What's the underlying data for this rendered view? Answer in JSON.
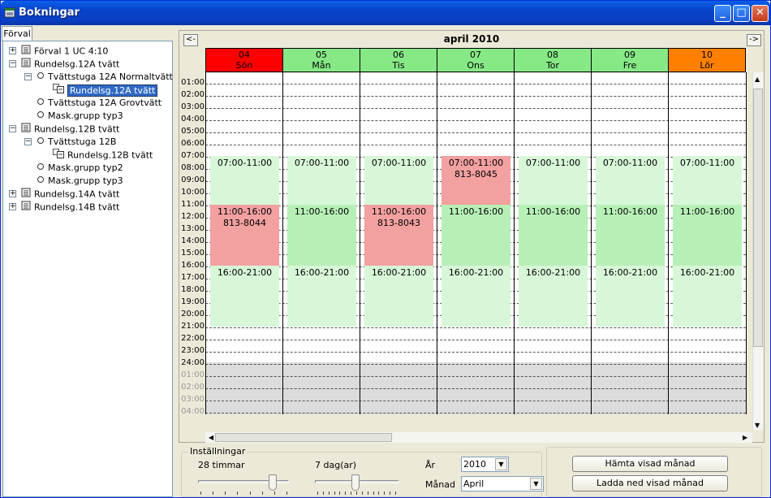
{
  "window": {
    "title": "Bokningar",
    "minimize": "_",
    "maximize": "□",
    "close": "✕"
  },
  "tab_label": "Förval",
  "tree": [
    {
      "label": "Förval   1 UC 4:10",
      "expander": "+",
      "icon": "list-icon"
    },
    {
      "label": "Rundelsg.12A tvätt",
      "expander": "−",
      "icon": "list-icon"
    },
    {
      "label": "Tvättstuga 12A Normaltvätt",
      "expander": "−",
      "icon": "circle-icon"
    },
    {
      "label": "Rundelsg.12A tvätt",
      "selected": true,
      "icon": "schedule-icon"
    },
    {
      "label": "Tvättstuga 12A Grovtvätt",
      "icon": "circle-icon"
    },
    {
      "label": "Mask.grupp typ3",
      "icon": "circle-icon"
    },
    {
      "label": "Rundelsg.12B tvätt",
      "expander": "−",
      "icon": "list-icon"
    },
    {
      "label": "Tvättstuga 12B",
      "expander": "−",
      "icon": "circle-icon"
    },
    {
      "label": "Rundelsg.12B tvätt",
      "icon": "schedule-icon"
    },
    {
      "label": "Mask.grupp typ2",
      "icon": "circle-icon"
    },
    {
      "label": "Mask.grupp typ3",
      "icon": "circle-icon"
    },
    {
      "label": "Rundelsg.14A tvätt",
      "expander": "+",
      "icon": "list-icon"
    },
    {
      "label": "Rundelsg.14B tvätt",
      "expander": "+",
      "icon": "list-icon"
    }
  ],
  "calendar": {
    "month_title": "april 2010",
    "prev": "<-",
    "next": "->",
    "days": [
      {
        "num": "04",
        "name": "Sön",
        "color": "#ff0000"
      },
      {
        "num": "05",
        "name": "Mån",
        "color": "#86e986"
      },
      {
        "num": "06",
        "name": "Tis",
        "color": "#86e986"
      },
      {
        "num": "07",
        "name": "Ons",
        "color": "#86e986"
      },
      {
        "num": "08",
        "name": "Tor",
        "color": "#86e986"
      },
      {
        "num": "09",
        "name": "Fre",
        "color": "#86e986"
      },
      {
        "num": "10",
        "name": "Lör",
        "color": "#ff8000"
      }
    ],
    "hours": [
      "01:00",
      "02:00",
      "03:00",
      "04:00",
      "05:00",
      "06:00",
      "07:00",
      "08:00",
      "09:00",
      "10:00",
      "11:00",
      "12:00",
      "13:00",
      "14:00",
      "15:00",
      "16:00",
      "17:00",
      "18:00",
      "19:00",
      "20:00",
      "21:00",
      "22:00",
      "23:00",
      "24:00",
      "01:00",
      "02:00",
      "03:00",
      "04:00"
    ],
    "slots": [
      [
        {
          "time": "07:00-11:00",
          "booking": "",
          "booked": false
        },
        {
          "time": "11:00-16:00",
          "booking": "813-8044",
          "booked": true
        },
        {
          "time": "16:00-21:00",
          "booking": "",
          "booked": false
        }
      ],
      [
        {
          "time": "07:00-11:00",
          "booking": "",
          "booked": false
        },
        {
          "time": "11:00-16:00",
          "booking": "",
          "booked": false
        },
        {
          "time": "16:00-21:00",
          "booking": "",
          "booked": false
        }
      ],
      [
        {
          "time": "07:00-11:00",
          "booking": "",
          "booked": false
        },
        {
          "time": "11:00-16:00",
          "booking": "813-8043",
          "booked": true
        },
        {
          "time": "16:00-21:00",
          "booking": "",
          "booked": false
        }
      ],
      [
        {
          "time": "07:00-11:00",
          "booking": "813-8045",
          "booked": true
        },
        {
          "time": "11:00-16:00",
          "booking": "",
          "booked": false
        },
        {
          "time": "16:00-21:00",
          "booking": "",
          "booked": false
        }
      ],
      [
        {
          "time": "07:00-11:00",
          "booking": "",
          "booked": false
        },
        {
          "time": "11:00-16:00",
          "booking": "",
          "booked": false
        },
        {
          "time": "16:00-21:00",
          "booking": "",
          "booked": false
        }
      ],
      [
        {
          "time": "07:00-11:00",
          "booking": "",
          "booked": false
        },
        {
          "time": "11:00-16:00",
          "booking": "",
          "booked": false
        },
        {
          "time": "16:00-21:00",
          "booking": "",
          "booked": false
        }
      ],
      [
        {
          "time": "07:00-11:00",
          "booking": "",
          "booked": false
        },
        {
          "time": "11:00-16:00",
          "booking": "",
          "booked": false
        },
        {
          "time": "16:00-21:00",
          "booking": "",
          "booked": false
        }
      ]
    ]
  },
  "settings": {
    "group_label": "Inställningar",
    "hours_label": "28 timmar",
    "days_label": "7 dag(ar)",
    "year_label": "År",
    "year_value": "2010",
    "month_label": "Månad",
    "month_value": "April",
    "fetch_button": "Hämta visad månad",
    "download_button": "Ladda ned visad månad"
  }
}
